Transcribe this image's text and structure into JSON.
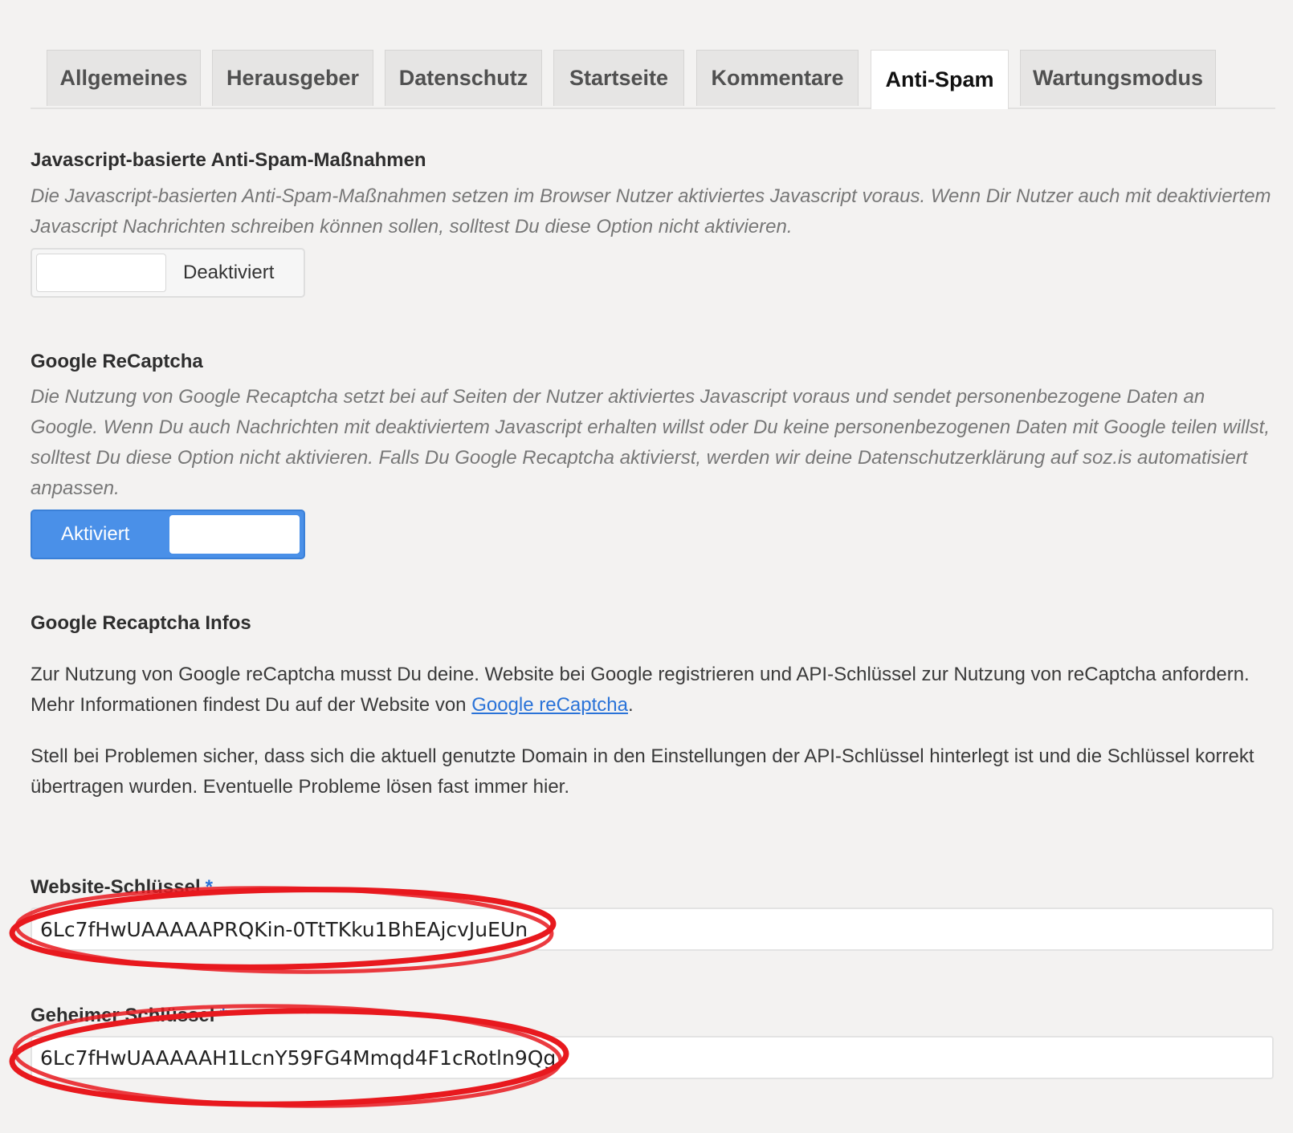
{
  "tabs": [
    {
      "label": "Allgemeines",
      "active": false
    },
    {
      "label": "Herausgeber",
      "active": false
    },
    {
      "label": "Datenschutz",
      "active": false
    },
    {
      "label": "Startseite",
      "active": false
    },
    {
      "label": "Kommentare",
      "active": false
    },
    {
      "label": "Anti-Spam",
      "active": true
    },
    {
      "label": "Wartungsmodus",
      "active": false
    }
  ],
  "js_antispam": {
    "title": "Javascript-basierte Anti-Spam-Maßnahmen",
    "description": "Die Javascript-basierten Anti-Spam-Maßnahmen setzen im Browser Nutzer aktiviertes Javascript voraus. Wenn Dir Nutzer auch mit deaktiviertem Javascript Nachrichten schreiben können sollen, solltest Du diese Option nicht aktivieren.",
    "toggle_label": "Deaktiviert",
    "enabled": false
  },
  "recaptcha": {
    "title": "Google ReCaptcha",
    "description": "Die Nutzung von Google Recaptcha setzt bei auf Seiten der Nutzer aktiviertes Javascript voraus und sendet personenbezogene Daten an Google. Wenn Du auch Nachrichten mit deaktiviertem Javascript erhalten willst oder Du keine personenbezogenen Daten mit Google teilen willst, solltest Du diese Option nicht aktivieren. Falls Du Google Recaptcha aktivierst, werden wir deine Datenschutzerklärung auf soz.is automatisiert anpassen.",
    "toggle_label": "Aktiviert",
    "enabled": true
  },
  "recaptcha_info": {
    "title": "Google Recaptcha Infos",
    "para1_text": "Zur Nutzung von Google reCaptcha musst Du deine. Website bei Google registrieren und API-Schlüssel zur Nutzung von reCaptcha anfordern. Mehr Informationen findest Du auf der Website von ",
    "para1_link": "Google reCaptcha",
    "para1_end": ".",
    "para2": "Stell bei Problemen sicher, dass sich die aktuell genutzte Domain in den Einstellungen der API-Schlüssel hinterlegt ist und die Schlüssel korrekt übertragen wurden. Eventuelle Probleme lösen fast immer hier."
  },
  "fields": {
    "site_key_label": "Website-Schlüssel",
    "site_key_required": "*",
    "site_key_value": "6Lc7fHwUAAAAAPRQKin-0TtTKku1BhEAjcvJuEUn",
    "secret_key_label": "Geheimer Schlüssel",
    "secret_key_required": "*",
    "secret_key_value": "6Lc7fHwUAAAAAH1LcnY59FG4Mmqd4F1cRotln9Qg"
  },
  "colors": {
    "accent": "#4a90e8",
    "link": "#2a73d8",
    "annotation": "#e8191e",
    "background": "#f3f2f1"
  }
}
